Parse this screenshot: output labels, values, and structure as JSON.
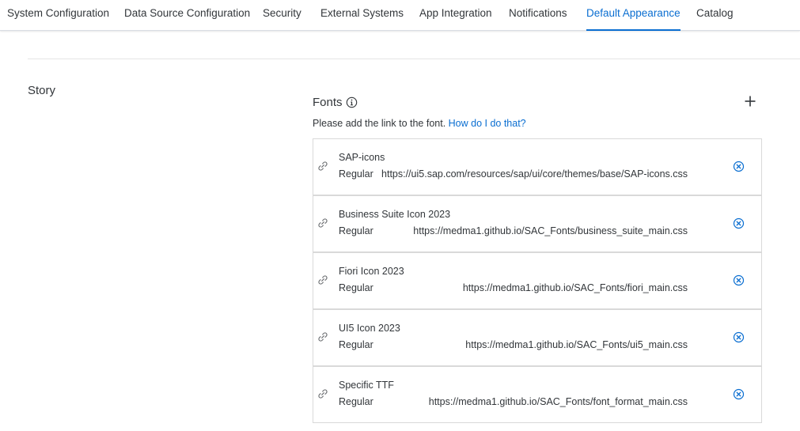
{
  "tabs": [
    {
      "label": "System Configuration",
      "active": false
    },
    {
      "label": "Data Source Configuration",
      "active": false
    },
    {
      "label": "Security",
      "active": false
    },
    {
      "label": "External Systems",
      "active": false
    },
    {
      "label": "App Integration",
      "active": false
    },
    {
      "label": "Notifications",
      "active": false
    },
    {
      "label": "Default Appearance",
      "active": true
    },
    {
      "label": "Catalog",
      "active": false
    }
  ],
  "section": {
    "title": "Story"
  },
  "fonts": {
    "header": "Fonts",
    "info_icon": "info-icon",
    "add_icon": "plus-icon",
    "hint_text": "Please add the link to the font.",
    "hint_link": "How do I do that?",
    "accent_color": "#0a6ed1",
    "items": [
      {
        "name": "SAP-icons",
        "style": "Regular",
        "url": "https://ui5.sap.com/resources/sap/ui/core/themes/base/SAP-icons.css"
      },
      {
        "name": "Business Suite Icon 2023",
        "style": "Regular",
        "url": "https://medma1.github.io/SAC_Fonts/business_suite_main.css"
      },
      {
        "name": "Fiori Icon 2023",
        "style": "Regular",
        "url": "https://medma1.github.io/SAC_Fonts/fiori_main.css"
      },
      {
        "name": "UI5 Icon 2023",
        "style": "Regular",
        "url": "https://medma1.github.io/SAC_Fonts/ui5_main.css"
      },
      {
        "name": "Specific TTF",
        "style": "Regular",
        "url": "https://medma1.github.io/SAC_Fonts/font_format_main.css"
      }
    ]
  }
}
